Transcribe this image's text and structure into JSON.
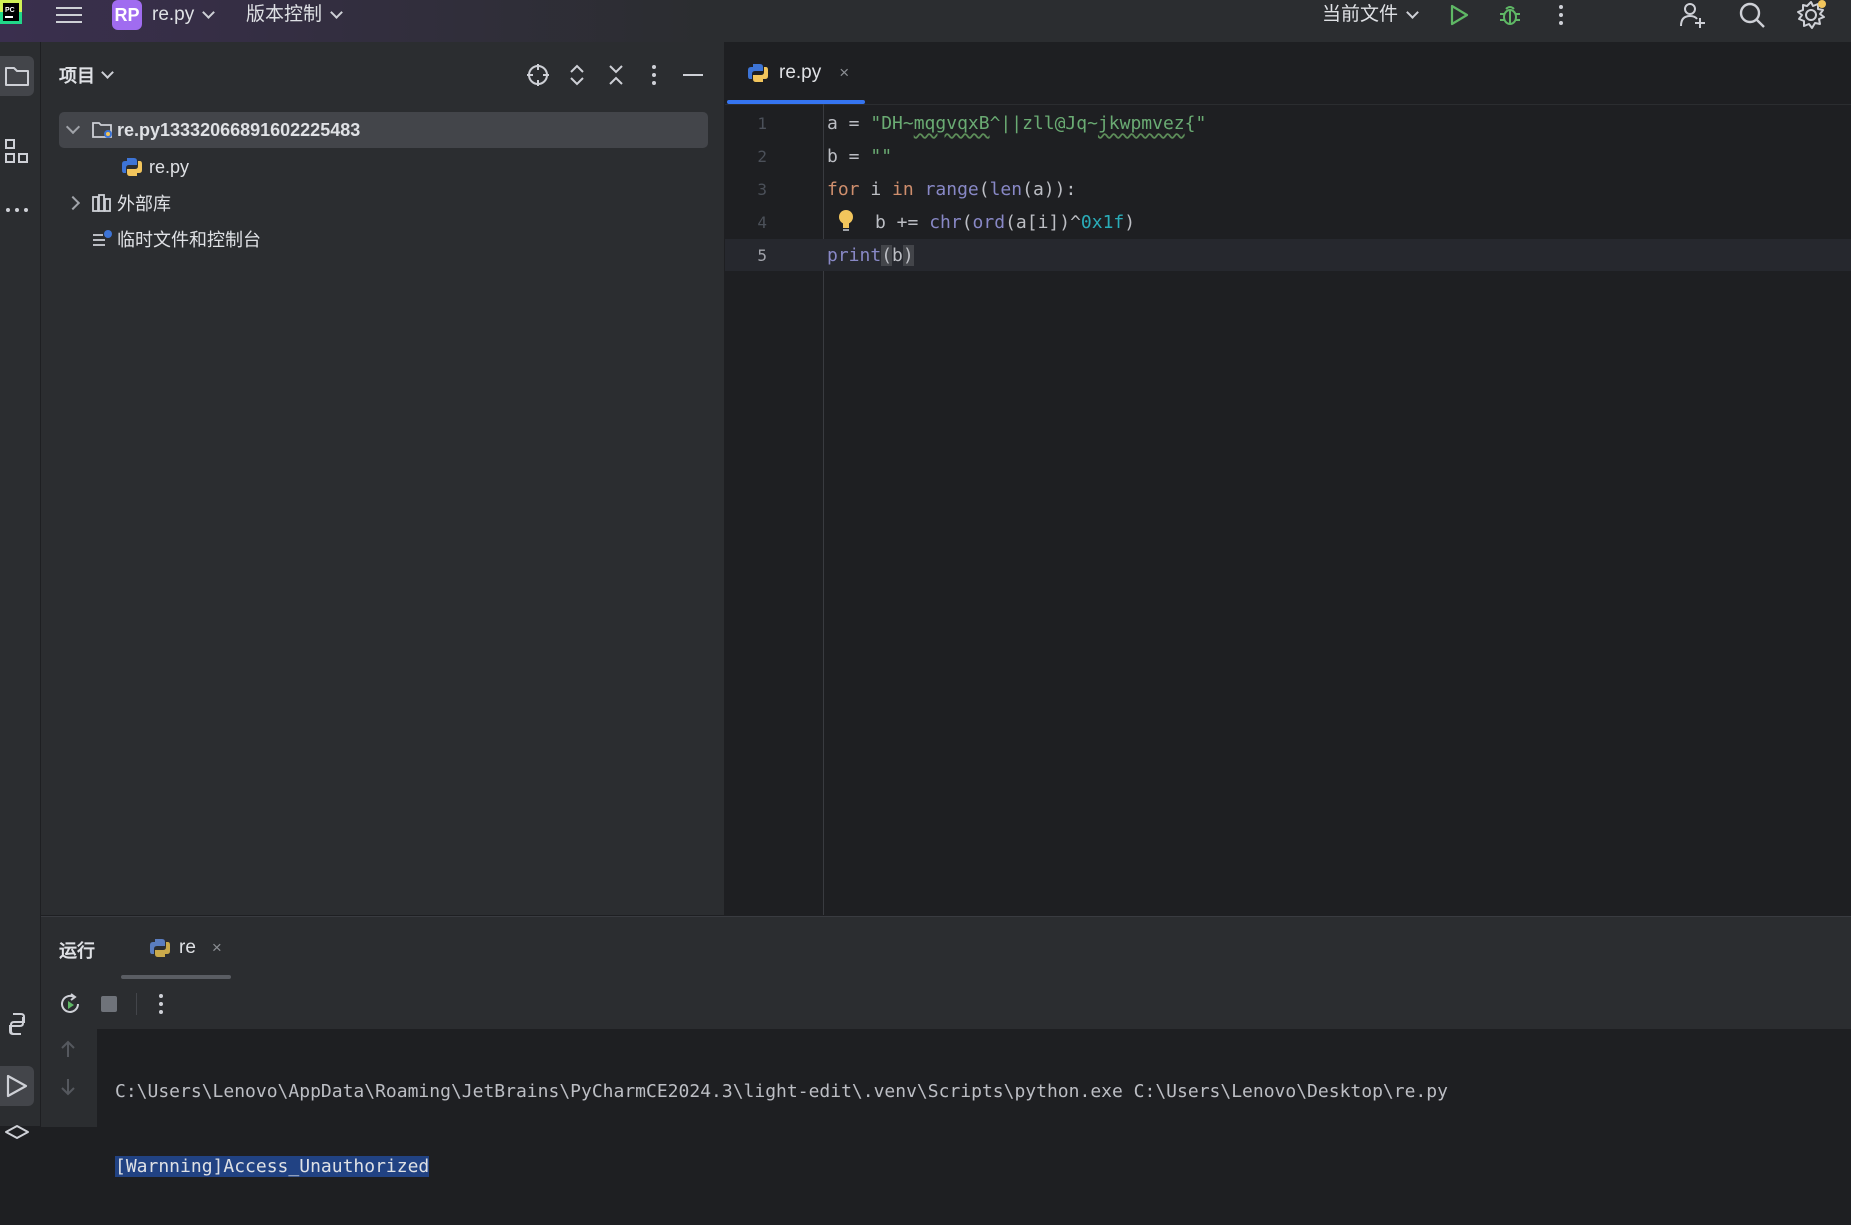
{
  "title_bar": {
    "project_badge": "RP",
    "project_name": "re.py",
    "vcs_menu": "版本控制",
    "run_config": "当前文件"
  },
  "project_panel": {
    "title": "项目",
    "tree": [
      {
        "label": "re.py13332066891602225483",
        "type": "folder",
        "expanded": true,
        "selected": true
      },
      {
        "label": "re.py",
        "type": "python-file"
      },
      {
        "label": "外部库",
        "type": "library",
        "expanded": false
      },
      {
        "label": "临时文件和控制台",
        "type": "scratches"
      }
    ]
  },
  "editor": {
    "tab_label": "re.py",
    "tab_close": "×",
    "line_numbers": [
      "1",
      "2",
      "3",
      "4",
      "5"
    ],
    "current_line": 5,
    "code": {
      "l1_var": "a",
      "l1_op": " = ",
      "l1_str_a": "\"DH~",
      "l1_str_b": "mqgvqxB",
      "l1_str_c": "^||zll@Jq~",
      "l1_str_d": "jkwpmvez",
      "l1_str_e": "{\"",
      "l2_var": "b",
      "l2_op": " = ",
      "l2_str": "\"\"",
      "l3_for": "for",
      "l3_mid": " i ",
      "l3_in": "in",
      "l3_range": "range",
      "l3_open": "(",
      "l3_len": "len",
      "l3_rest": "(a)):",
      "l4_pre": "b += ",
      "l4_chr": "chr",
      "l4_open": "(",
      "l4_ord": "ord",
      "l4_mid": "(a[i])^",
      "l4_hex": "0x1f",
      "l4_close": ")",
      "l5_print": "print",
      "l5_open": "(",
      "l5_arg": "b",
      "l5_close": ")"
    }
  },
  "run_panel": {
    "title": "运行",
    "tab_label": "re",
    "tab_close": "×",
    "console": {
      "command": "C:\\Users\\Lenovo\\AppData\\Roaming\\JetBrains\\PyCharmCE2024.3\\light-edit\\.venv\\Scripts\\python.exe C:\\Users\\Lenovo\\Desktop\\re.py",
      "output": "[Warnning]Access_Unauthorized"
    }
  },
  "colors": {
    "accent": "#3574f0",
    "badge": "#a06cf0",
    "run_green": "#5fb865",
    "keyword": "#cf8e6d",
    "string": "#6aab73",
    "builtin": "#8888c6",
    "number": "#2aacb8",
    "selection": "#214283"
  }
}
